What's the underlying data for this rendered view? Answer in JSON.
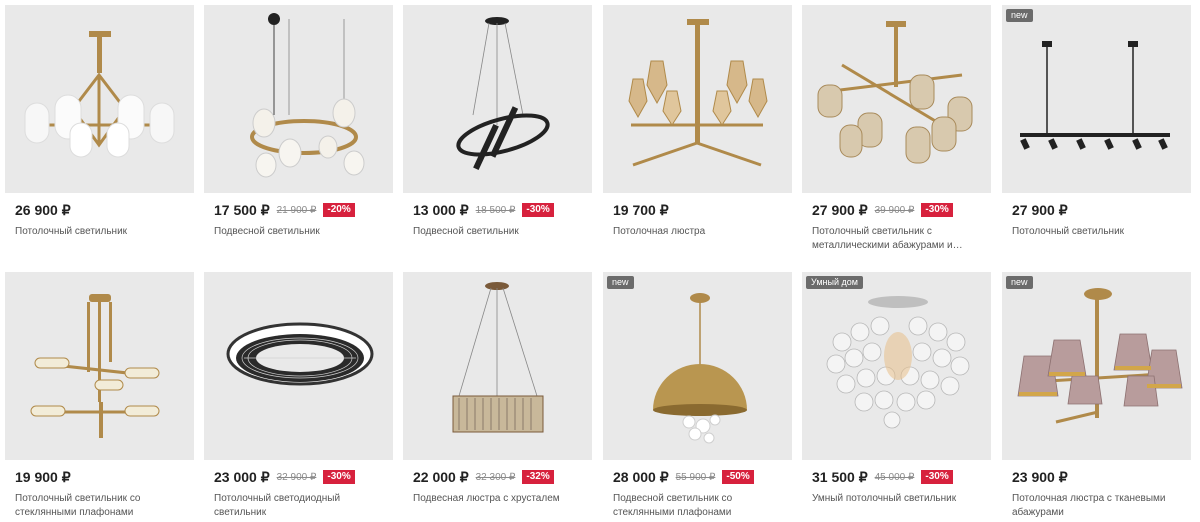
{
  "colors": {
    "discount": "#d7213d",
    "badge": "#6b6b6b",
    "image_bg": "#e9e9e9"
  },
  "products": [
    {
      "price": "26 900 ₽",
      "old_price": "",
      "discount": "",
      "badge": "",
      "title": "Потолочный светильник",
      "icon": "chandelier-white-shades"
    },
    {
      "price": "17 500 ₽",
      "old_price": "21 900 ₽",
      "discount": "-20%",
      "badge": "",
      "title": "Подвесной светильник",
      "icon": "pendant-ring-glass"
    },
    {
      "price": "13 000 ₽",
      "old_price": "18 500 ₽",
      "discount": "-30%",
      "badge": "",
      "title": "Подвесной светильник",
      "icon": "pendant-led-rings"
    },
    {
      "price": "19 700 ₽",
      "old_price": "",
      "discount": "",
      "badge": "",
      "title": "Потолочная люстра",
      "icon": "chandelier-amber-glass"
    },
    {
      "price": "27 900 ₽",
      "old_price": "39 900 ₽",
      "discount": "-30%",
      "badge": "",
      "title": "Потолочный светильник с металлическими абажурами и…",
      "icon": "chandelier-mesh-shades"
    },
    {
      "price": "27 900 ₽",
      "old_price": "",
      "discount": "",
      "badge": "new",
      "title": "Потолочный светильник",
      "icon": "track-spotlights"
    },
    {
      "price": "19 900 ₽",
      "old_price": "",
      "discount": "",
      "badge": "",
      "title": "Потолочный светильник со стеклянными плафонами",
      "icon": "chandelier-glass-tubes"
    },
    {
      "price": "23 000 ₽",
      "old_price": "32 900 ₽",
      "discount": "-30%",
      "badge": "",
      "title": "Потолочный светодиодный светильник",
      "icon": "led-ring-ceiling"
    },
    {
      "price": "22 000 ₽",
      "old_price": "32 300 ₽",
      "discount": "-32%",
      "badge": "",
      "title": "Подвесная люстра с хрусталем",
      "icon": "crystal-drum-pendant"
    },
    {
      "price": "28 000 ₽",
      "old_price": "55 900 ₽",
      "discount": "-50%",
      "badge": "new",
      "title": "Подвесной светильник со стеклянными плафонами",
      "icon": "dome-pendant"
    },
    {
      "price": "31 500 ₽",
      "old_price": "45 000 ₽",
      "discount": "-30%",
      "badge": "Умный дом",
      "title": "Умный потолочный светильник",
      "icon": "shell-disc-chandelier"
    },
    {
      "price": "23 900 ₽",
      "old_price": "",
      "discount": "",
      "badge": "new",
      "title": "Потолочная люстра с тканевыми абажурами",
      "icon": "fabric-shade-chandelier"
    }
  ]
}
